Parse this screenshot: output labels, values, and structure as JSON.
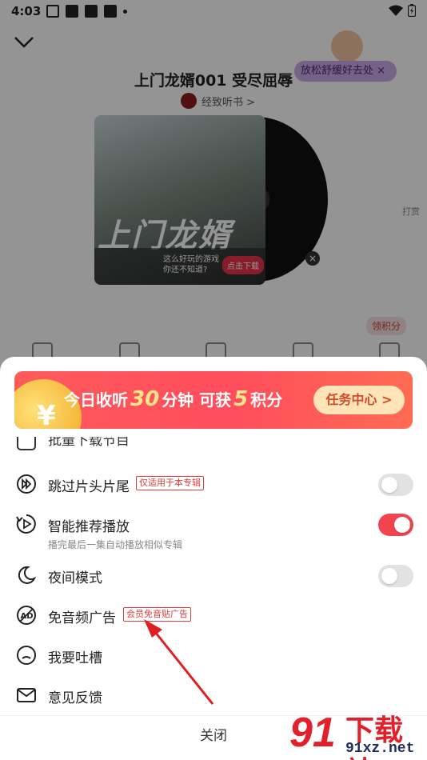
{
  "status_bar": {
    "time": "4:03"
  },
  "player": {
    "ad_pill": "放松舒缓好去处",
    "track_title": "上门龙婿001 受尽屈辱",
    "author": "经致听书 >",
    "cover_title": "上门龙婿",
    "cover_ad": {
      "question_line1": "这么好玩的游戏",
      "question_line2": "你还不知道?",
      "cta": "点击下载"
    },
    "side_reward": "打赏",
    "earn_points": "领积分"
  },
  "banner": {
    "prefix": "今日收听",
    "minutes": "30",
    "middle": "分钟  可获",
    "points": "5",
    "suffix": "积分",
    "button": "任务中心 >"
  },
  "partial_row": {
    "label": "批量下载节目"
  },
  "settings": [
    {
      "id": "skip-intro-outro",
      "label": "跳过片头片尾",
      "tag": "仅适用于本专辑",
      "toggle": "off",
      "icon": "skip-forward-icon"
    },
    {
      "id": "smart-recommend-play",
      "label": "智能推荐播放",
      "subtitle": "播完最后一集自动播放相似专辑",
      "toggle": "on",
      "icon": "autoplay-icon"
    },
    {
      "id": "night-mode",
      "label": "夜间模式",
      "toggle": "off",
      "icon": "moon-icon"
    },
    {
      "id": "ad-free-audio",
      "label": "免音频广告",
      "tag": "会员免音贴广告",
      "icon": "no-ad-icon"
    },
    {
      "id": "complain",
      "label": "我要吐槽",
      "icon": "sad-face-icon"
    },
    {
      "id": "feedback",
      "label": "意见反馈",
      "icon": "mail-icon"
    }
  ],
  "close_button": "关闭",
  "colors": {
    "accent": "#f0444e",
    "tag_red": "#e23b3b",
    "toggle_off": "#e2e2e2"
  },
  "watermark": {
    "logo": "91",
    "name": "下载站",
    "url": "91xz.net"
  }
}
